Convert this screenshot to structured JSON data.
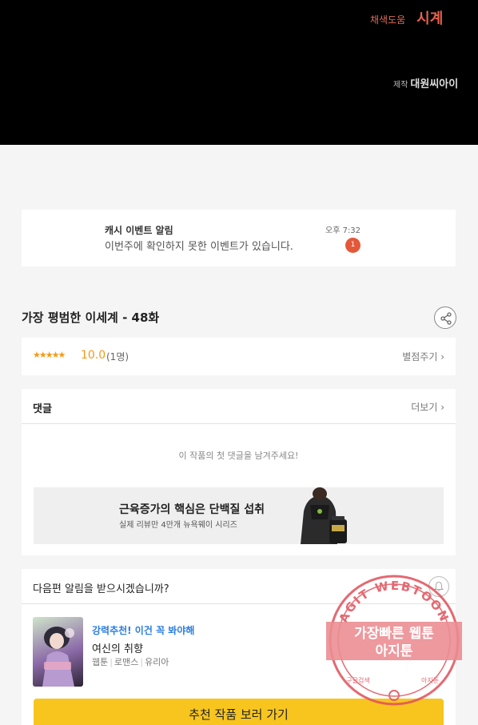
{
  "hero": {
    "color_credit_label": "채색도움",
    "color_credit_name": "시계",
    "production_label": "제작",
    "production_name": "대원씨아이"
  },
  "notification": {
    "title": "캐시 이벤트 알림",
    "body": "이번주에 확인하지 못한 이벤트가 있습니다.",
    "time": "오후 7:32",
    "badge_count": "1"
  },
  "episode": {
    "title": "가장 평범한 이세계 - 48화",
    "share_icon": "share-icon"
  },
  "rating": {
    "stars": "★★★★★",
    "score": "10.0",
    "count": "(1명)",
    "rate_link": "별점주기 ›"
  },
  "comments": {
    "title": "댓글",
    "more": "더보기 ›",
    "empty_message": "이 작품의 첫 댓글을 남겨주세요!"
  },
  "ad": {
    "title": "근육증가의 핵심은 단백질 섭취",
    "subtitle": "실제 리뷰만 4만개 뉴욕웨이 시리즈"
  },
  "next_episode": {
    "question": "다음편 알림을 받으시겠습니까?",
    "bell_icon": "bell-icon"
  },
  "recommendation": {
    "tag": "강력추천! 이건 꼭 봐야해",
    "title": "여신의 취향",
    "genres": [
      "웹툰",
      "로맨스",
      "유리아"
    ],
    "cta": "추천 작품 보러 가기"
  },
  "watermark": {
    "arc_text": "AGIT WEBTOON",
    "line1": "가장빠른 웹툰",
    "line2": "아지툰",
    "bottom_left": "구글검색",
    "bottom_right": "아지툰"
  },
  "colors": {
    "accent_orange": "#f29a19",
    "badge_red": "#e4583a",
    "cta_yellow": "#f7c51e",
    "link_blue": "#2a7de1",
    "stamp_red": "#e0505a"
  }
}
